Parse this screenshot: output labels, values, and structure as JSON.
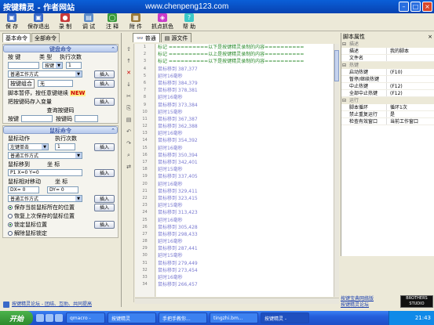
{
  "window": {
    "title": "按键精灵 - 作者网站",
    "url": "www.chenpeng123.com"
  },
  "toolbar": [
    {
      "label": "保 存",
      "icon": "save-icon",
      "color": "#3a6ac8"
    },
    {
      "label": "保存退出",
      "icon": "save-exit-icon",
      "color": "#3a6ac8"
    },
    {
      "label": "录 制",
      "icon": "record-icon",
      "color": "#c83a3a"
    },
    {
      "label": "调 试",
      "icon": "debug-icon",
      "color": "#5a8ac8"
    },
    {
      "label": "注 释",
      "icon": "comment-icon",
      "color": "#3a9a3a"
    },
    {
      "label": "附 件",
      "icon": "attachment-icon",
      "color": "#9a7a3a"
    },
    {
      "label": "抓点抓色",
      "icon": "eyedropper-icon",
      "color": "#c83ac8"
    },
    {
      "label": "帮 助",
      "icon": "help-icon",
      "color": "#3ac8c8"
    }
  ],
  "left_tabs": [
    "基本命令",
    "全部命令"
  ],
  "keyboard": {
    "header": "键盘命令",
    "key_label": "按 键",
    "type_label": "类 型",
    "count_label": "执行次数",
    "type_value": "按键",
    "count_value": "1",
    "workmode": "普通工作方式",
    "combo_label": "按键组合",
    "combo_value": "无",
    "pause_label": "脚本暂停，按任意键继续",
    "new_badge": "NEW",
    "save_key_label": "把按键码存入变量",
    "query_label": "查询按键码",
    "query_key": "按键",
    "query_code": "按键码",
    "insert": "插入"
  },
  "mouse": {
    "header": "鼠标命令",
    "action_label": "鼠标动作",
    "count_label": "执行次数",
    "action_value": "左键单击",
    "count_value": "1",
    "workmode": "普通工作方式",
    "move_label": "鼠标移到",
    "coord_label": "坐 标",
    "move_value": "P1 X=0 Y=0",
    "rel_label": "鼠标相对移动",
    "rel_coord": "坐 标",
    "dx": "DX= 0",
    "dy": "DY= 0",
    "workmode2": "普通工作方式",
    "save_pos": "保存当前鼠标所在的位置",
    "restore_pos": "恢复上次保存的鼠标位置",
    "lock_pos": "锁定鼠标位置",
    "unlock_pos": "解除鼠标锁定",
    "insert": "插入"
  },
  "editor_tabs": [
    "普通",
    "源文件"
  ],
  "code_lines": [
    {
      "n": "1",
      "text": "标记 ==========以下是按键精灵录制的内容==========",
      "kind": "note"
    },
    {
      "n": "2",
      "text": "标记 ==========以上是按键精灵录制的内容==========",
      "kind": "note"
    },
    {
      "n": "3",
      "text": "标记 ==========以下是按键精灵录制的内容==========",
      "kind": "note"
    },
    {
      "n": "4",
      "text": "鼠标移到 387,377",
      "kind": "act"
    },
    {
      "n": "5",
      "text": "延时16毫秒",
      "kind": "act"
    },
    {
      "n": "6",
      "text": "鼠标移到 384,379",
      "kind": "act"
    },
    {
      "n": "7",
      "text": "鼠标移到 378,381",
      "kind": "act"
    },
    {
      "n": "8",
      "text": "延时16毫秒",
      "kind": "act"
    },
    {
      "n": "9",
      "text": "鼠标移到 373,384",
      "kind": "act"
    },
    {
      "n": "10",
      "text": "延时15毫秒",
      "kind": "act"
    },
    {
      "n": "11",
      "text": "鼠标移到 367,387",
      "kind": "act"
    },
    {
      "n": "12",
      "text": "鼠标移到 362,388",
      "kind": "act"
    },
    {
      "n": "13",
      "text": "延时16毫秒",
      "kind": "act"
    },
    {
      "n": "14",
      "text": "鼠标移到 354,392",
      "kind": "act"
    },
    {
      "n": "15",
      "text": "延时16毫秒",
      "kind": "act"
    },
    {
      "n": "16",
      "text": "鼠标移到 350,394",
      "kind": "act"
    },
    {
      "n": "17",
      "text": "鼠标移到 342,401",
      "kind": "act"
    },
    {
      "n": "18",
      "text": "延时15毫秒",
      "kind": "act"
    },
    {
      "n": "19",
      "text": "鼠标移到 337,405",
      "kind": "act"
    },
    {
      "n": "20",
      "text": "延时16毫秒",
      "kind": "act"
    },
    {
      "n": "21",
      "text": "鼠标移到 329,411",
      "kind": "act"
    },
    {
      "n": "22",
      "text": "鼠标移到 323,415",
      "kind": "act"
    },
    {
      "n": "23",
      "text": "延时15毫秒",
      "kind": "act"
    },
    {
      "n": "24",
      "text": "鼠标移到 313,423",
      "kind": "act"
    },
    {
      "n": "25",
      "text": "延时16毫秒",
      "kind": "act"
    },
    {
      "n": "26",
      "text": "鼠标移到 305,428",
      "kind": "act"
    },
    {
      "n": "27",
      "text": "鼠标移到 298,433",
      "kind": "act"
    },
    {
      "n": "28",
      "text": "延时16毫秒",
      "kind": "act"
    },
    {
      "n": "29",
      "text": "鼠标移到 287,441",
      "kind": "act"
    },
    {
      "n": "30",
      "text": "延时15毫秒",
      "kind": "act"
    },
    {
      "n": "31",
      "text": "鼠标移到 279,449",
      "kind": "act"
    },
    {
      "n": "32",
      "text": "鼠标移到 273,454",
      "kind": "act"
    },
    {
      "n": "33",
      "text": "延时16毫秒",
      "kind": "act"
    },
    {
      "n": "34",
      "text": "鼠标移到 266,457",
      "kind": "act"
    }
  ],
  "properties": {
    "title": "脚本属性",
    "categories": [
      {
        "name": "描述",
        "rows": [
          {
            "k": "描述",
            "v": "我的脚本"
          },
          {
            "k": "文件名",
            "v": ""
          }
        ]
      },
      {
        "name": "热键",
        "rows": [
          {
            "k": "启动热键",
            "v": "(F10)"
          },
          {
            "k": "暂停/继续热键",
            "v": ""
          },
          {
            "k": "中止热键",
            "v": "(F12)"
          },
          {
            "k": "全部中止热键",
            "v": "(F12)"
          }
        ]
      },
      {
        "name": "运行",
        "rows": [
          {
            "k": "脚本循环",
            "v": "循环1次"
          },
          {
            "k": "禁止重复运行",
            "v": "是"
          },
          {
            "k": "检查有效窗口",
            "v": "当前工作窗口"
          }
        ]
      }
    ]
  },
  "forum_links": [
    "按键宝典网络版",
    "按键精灵论坛"
  ],
  "brothers_text": "BROTHERS STUDIO",
  "status_link": "按键精灵论坛 - 团结、互助、共同提高",
  "taskbar": {
    "start": "开始",
    "tasks": [
      "qmacro -",
      "按键精灵",
      "手把手教你...",
      "tingzhi.bm...",
      "按键精灵 -"
    ],
    "clock": "21:43"
  }
}
